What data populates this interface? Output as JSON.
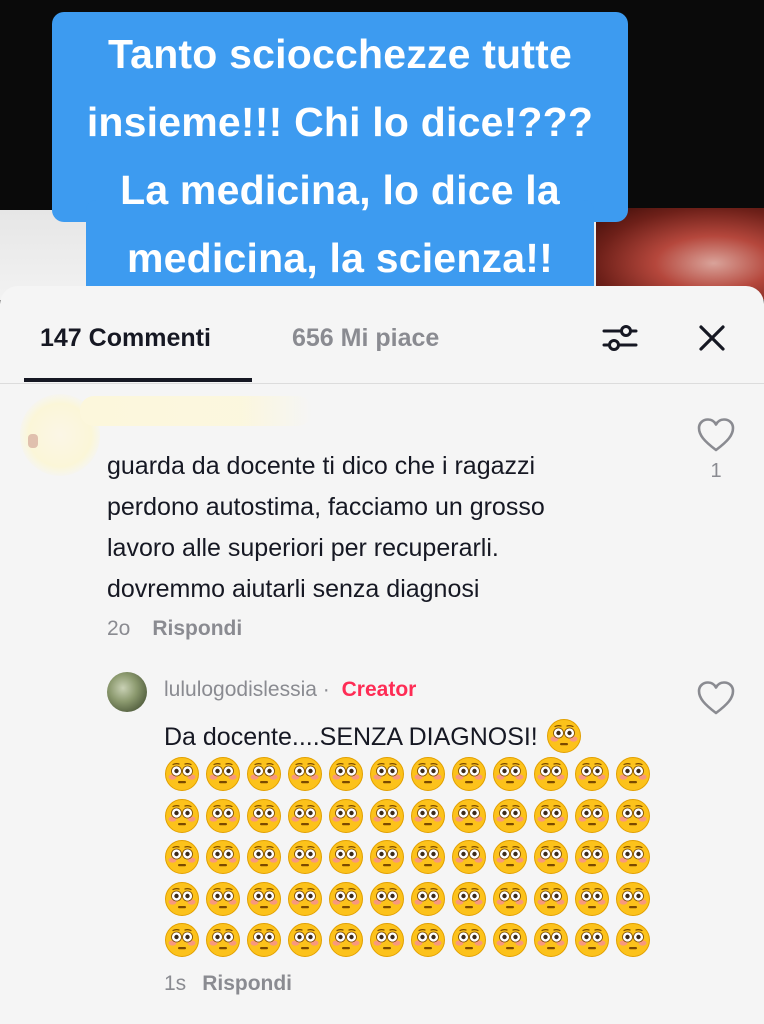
{
  "video": {
    "caption_lines": [
      "Tanto sciocchezze tutte",
      "insieme!!! Chi lo dice!???",
      "La medicina, lo dice la",
      "medicina, la scienza!!"
    ]
  },
  "tabs": {
    "comments_label": "147 Commenti",
    "likes_label": "656 Mi piace"
  },
  "icons": {
    "filter": "sliders-icon",
    "close": "close-icon",
    "like": "heart-outline-icon",
    "emoji": "flushed-face-emoji"
  },
  "colors": {
    "caption_bg": "#3d9bf0",
    "creator": "#fe2c55",
    "text": "#161823",
    "secondary": "#8a8b91"
  },
  "comment": {
    "lines": [
      "guarda da docente ti dico che i ragazzi",
      "perdono autostima, facciamo un grosso",
      "lavoro alle superiori per recuperarli.",
      "dovremmo aiutarli senza diagnosi"
    ],
    "time": "2o",
    "reply_label": "Rispondi",
    "likes": "1"
  },
  "reply": {
    "author": "lululogodislessia",
    "separator": "·",
    "badge": "Creator",
    "text": "Da docente....SENZA DIAGNOSI!",
    "emoji_rows": 5,
    "emojis_per_row": 12,
    "time": "1s",
    "reply_label": "Rispondi"
  }
}
